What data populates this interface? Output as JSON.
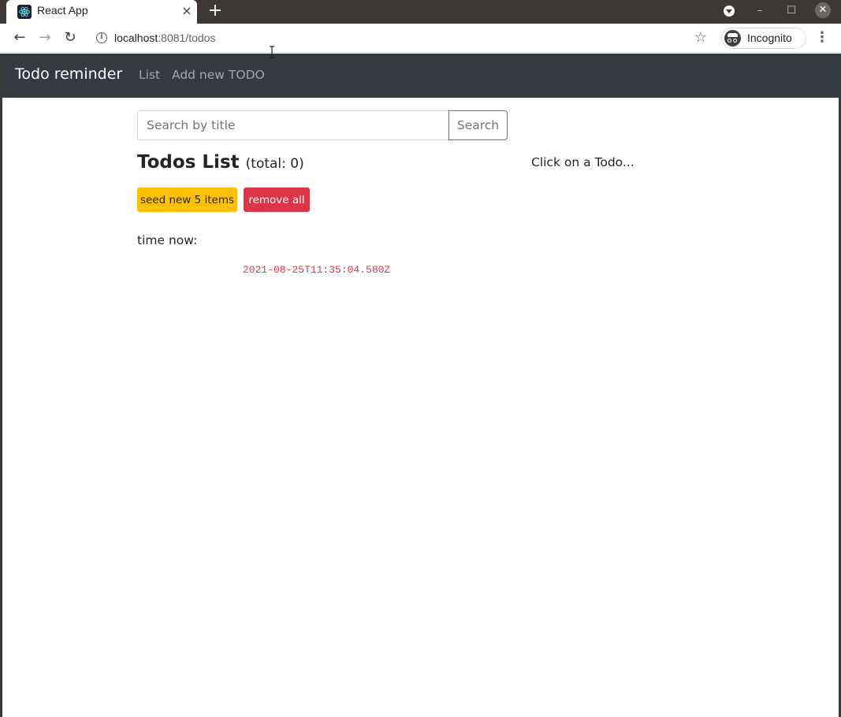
{
  "browser": {
    "tab_title": "React App",
    "tab_close": "×",
    "new_tab": "+",
    "url_host": "localhost",
    "url_rest": ":8081/todos",
    "incognito_label": "Incognito",
    "icons": [
      "react-favicon-icon",
      "back-arrow-icon",
      "forward-arrow-icon",
      "reload-icon",
      "info-icon",
      "star-icon",
      "incognito-icon",
      "kebab-menu-icon"
    ]
  },
  "navbar": {
    "brand": "Todo reminder",
    "links": [
      "List",
      "Add new TODO"
    ]
  },
  "search": {
    "placeholder": "Search by title",
    "value": "",
    "button_label": "Search"
  },
  "list": {
    "title": "Todos List",
    "total": "(total: 0)",
    "seed_label": "seed new 5 items",
    "remove_label": "remove all",
    "time_label": "time now:",
    "time_value": "2021-08-25T11:35:04.580Z"
  },
  "detail": {
    "hint": "Click on a Todo..."
  },
  "colors": {
    "navbar_bg": "#343a40",
    "warning": "#ffc107",
    "danger": "#dc3545",
    "code": "#d63a4a"
  }
}
